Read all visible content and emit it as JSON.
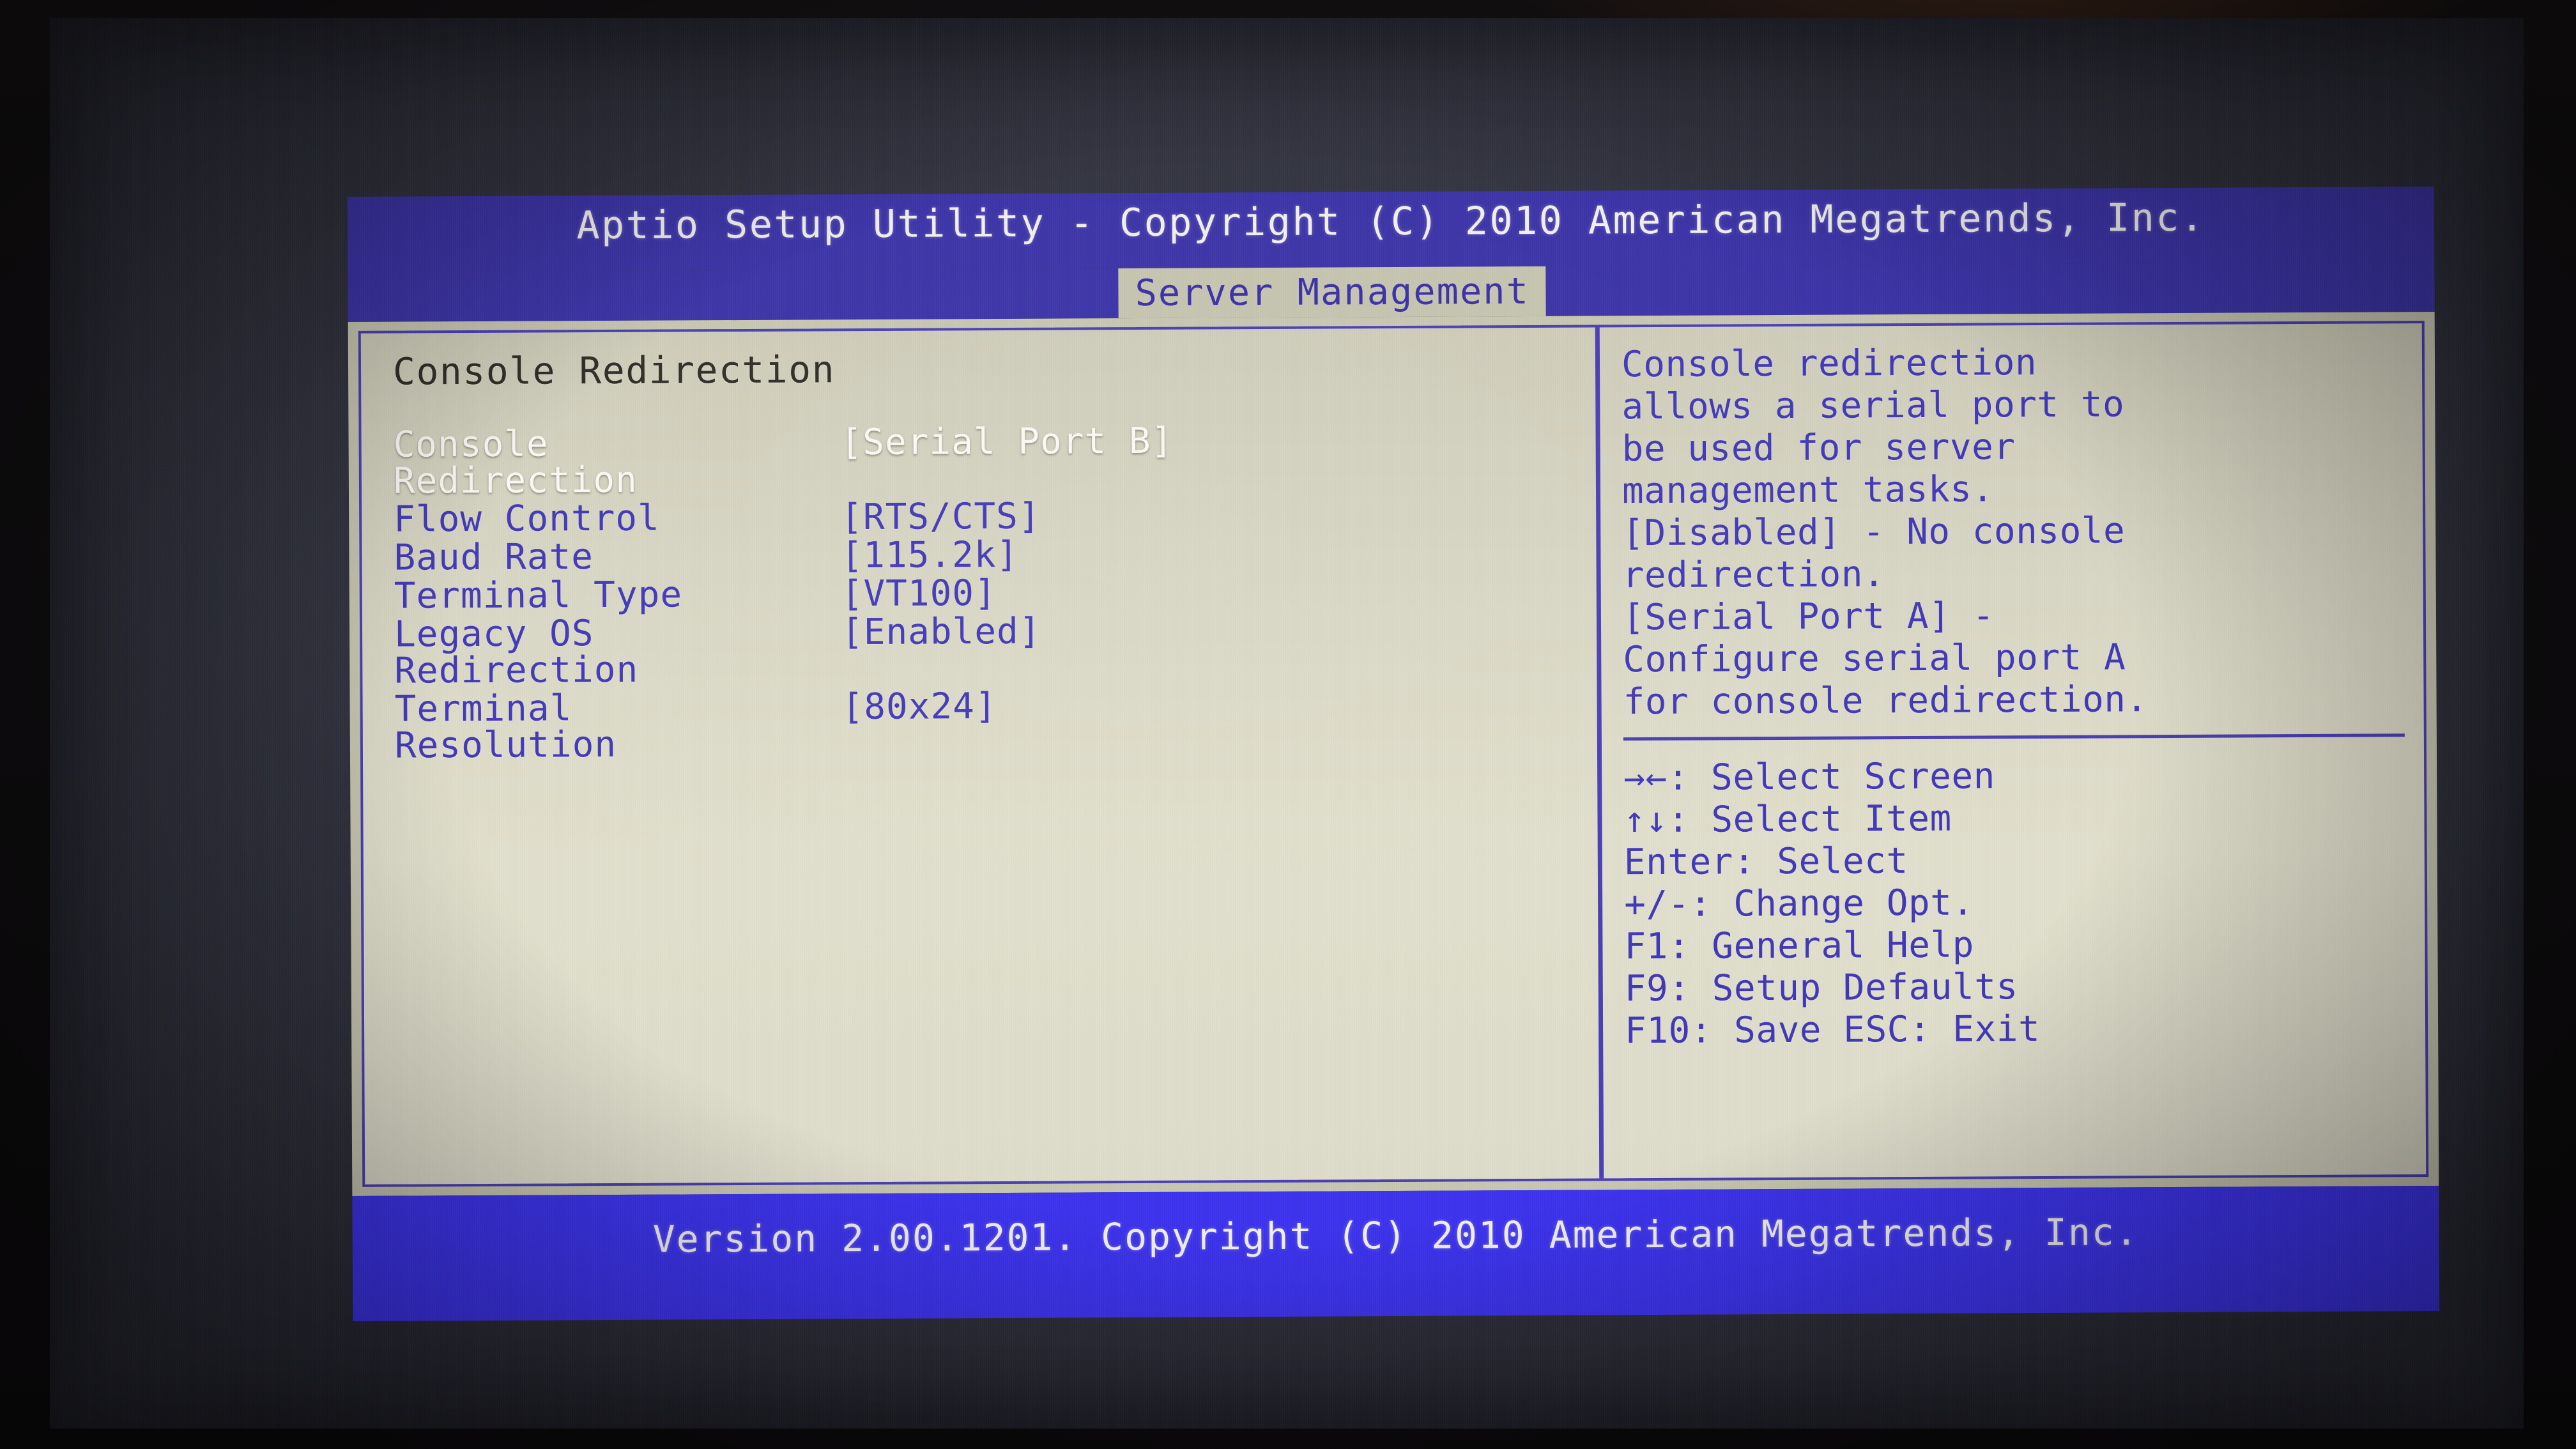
{
  "header": {
    "title": "Aptio Setup Utility - Copyright (C) 2010 American Megatrends, Inc.",
    "active_tab": "Server Management"
  },
  "main": {
    "section_heading": "Console Redirection",
    "settings": [
      {
        "label": "Console\nRedirection",
        "value": "[Serial Port B]",
        "selected": true
      },
      {
        "label": "Flow Control",
        "value": "[RTS/CTS]",
        "selected": false
      },
      {
        "label": "Baud Rate",
        "value": "[115.2k]",
        "selected": false
      },
      {
        "label": "Terminal Type",
        "value": "[VT100]",
        "selected": false
      },
      {
        "label": "Legacy OS\nRedirection",
        "value": "[Enabled]",
        "selected": false
      },
      {
        "label": "Terminal\nResolution",
        "value": "[80x24]",
        "selected": false
      }
    ]
  },
  "help": {
    "description": "Console redirection\nallows a serial port to\nbe used for server\nmanagement tasks.\n[Disabled] - No console\nredirection.\n[Serial Port A] -\nConfigure serial port A\nfor console redirection.",
    "keys": "→←: Select Screen\n↑↓: Select Item\nEnter: Select\n+/-: Change Opt.\nF1: General Help\nF9: Setup Defaults\nF10: Save  ESC: Exit"
  },
  "footer": {
    "version": "Version 2.00.1201. Copyright (C) 2010 American Megatrends, Inc."
  },
  "colors": {
    "header_blue": "#3c34a8",
    "footer_blue": "#3d33ef",
    "panel_beige": "#dedccb",
    "text_blue": "#4238b8",
    "selected_white": "#fbfaf6",
    "heading_dark": "#2e2d26"
  }
}
